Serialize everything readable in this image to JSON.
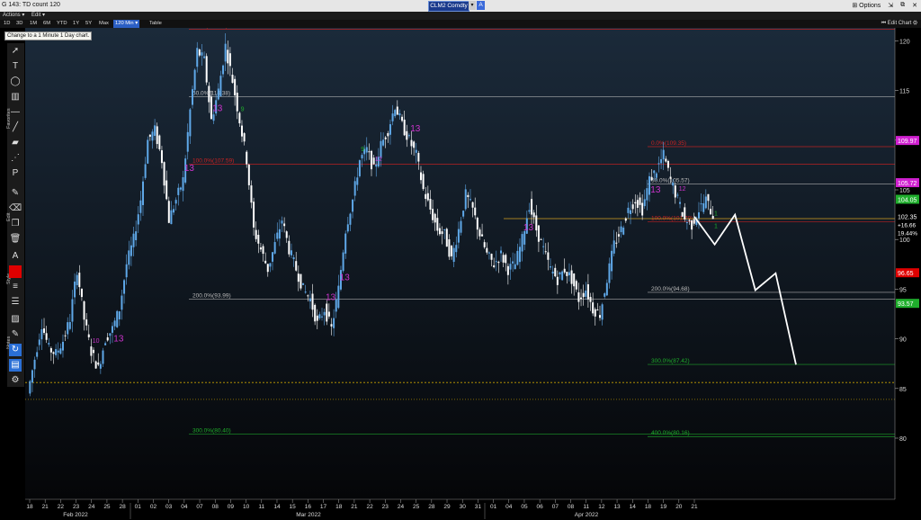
{
  "app": {
    "title": "G 143: TD count 120",
    "ticker": "CLM2 Comdty",
    "ticker_button": "A",
    "options_label": "Options",
    "window_controls": [
      "⇲",
      "⧉",
      "✕"
    ]
  },
  "menu": {
    "items": [
      "Actions ▾",
      "Edit ▾"
    ]
  },
  "range_buttons": [
    "1D",
    "3D",
    "1M",
    "6M",
    "YTD",
    "1Y",
    "5Y",
    "Max",
    "120 Min ▾",
    "Table"
  ],
  "edit_chart_label": "⏮ Edit Chart ⚙",
  "tooltip": "Change to a 1 Minute 1 Day chart.",
  "sidebar_labels": {
    "favorites": "Favorites",
    "edit": "Edit",
    "style": "Style",
    "notes": "Notes"
  },
  "colors": {
    "background": "#000000",
    "up_candle": "#5fa8e8",
    "down_candle": "#ffffff",
    "fib_red": "#cc2222",
    "fib_green": "#1fae2c",
    "magenta": "#cc33cc",
    "projection": "#ffffff"
  },
  "chart_data": {
    "type": "candlestick",
    "y_ticks": [
      80,
      85,
      90,
      95,
      100,
      105,
      110,
      115,
      120
    ],
    "ylim": [
      75,
      122
    ],
    "x_day_labels": [
      "18",
      "21",
      "22",
      "23",
      "24",
      "25",
      "28",
      "01",
      "02",
      "03",
      "04",
      "07",
      "08",
      "09",
      "10",
      "11",
      "14",
      "15",
      "16",
      "17",
      "18",
      "21",
      "22",
      "23",
      "24",
      "25",
      "28",
      "29",
      "30",
      "31",
      "01",
      "04",
      "05",
      "06",
      "07",
      "08",
      "11",
      "12",
      "13",
      "14",
      "18",
      "19",
      "20",
      "21"
    ],
    "month_labels": [
      "Feb 2022",
      "Mar 2022",
      "Apr 2022"
    ],
    "price_path": [
      [
        0,
        84.5
      ],
      [
        2,
        88
      ],
      [
        4,
        91.5
      ],
      [
        5,
        89
      ],
      [
        6,
        88.5
      ],
      [
        7,
        89.8
      ],
      [
        8,
        92
      ],
      [
        9,
        97
      ],
      [
        10,
        92
      ],
      [
        11,
        88.7
      ],
      [
        12,
        87
      ],
      [
        13,
        90
      ],
      [
        14,
        91
      ],
      [
        15,
        93
      ],
      [
        16,
        97.5
      ],
      [
        17,
        100
      ],
      [
        18,
        104
      ],
      [
        19,
        110
      ],
      [
        20,
        111
      ],
      [
        21,
        108
      ],
      [
        22,
        102
      ],
      [
        23,
        104
      ],
      [
        24,
        106
      ],
      [
        25,
        113
      ],
      [
        26,
        119
      ],
      [
        27,
        118
      ],
      [
        28,
        112
      ],
      [
        29,
        115
      ],
      [
        30,
        119.5
      ],
      [
        31,
        116
      ],
      [
        32,
        112
      ],
      [
        33,
        108
      ],
      [
        34,
        101
      ],
      [
        35,
        99
      ],
      [
        36,
        97
      ],
      [
        37,
        99.5
      ],
      [
        38,
        102
      ],
      [
        39,
        99
      ],
      [
        40,
        97
      ],
      [
        41,
        95
      ],
      [
        42,
        94
      ],
      [
        43,
        91.5
      ],
      [
        44,
        93
      ],
      [
        45,
        91
      ],
      [
        46,
        95
      ],
      [
        47,
        101
      ],
      [
        48,
        104
      ],
      [
        49,
        108
      ],
      [
        50,
        109
      ],
      [
        51,
        107
      ],
      [
        52,
        109.5
      ],
      [
        53,
        111
      ],
      [
        54,
        113.5
      ],
      [
        55,
        111.5
      ],
      [
        56,
        110
      ],
      [
        57,
        108.5
      ],
      [
        58,
        105
      ],
      [
        59,
        103
      ],
      [
        60,
        101
      ],
      [
        61,
        100.5
      ],
      [
        62,
        98
      ],
      [
        63,
        101
      ],
      [
        64,
        104.5
      ],
      [
        65,
        103
      ],
      [
        66,
        100.5
      ],
      [
        67,
        98.5
      ],
      [
        68,
        97.5
      ],
      [
        69,
        98.5
      ],
      [
        70,
        97
      ],
      [
        71,
        97.5
      ],
      [
        72,
        100
      ],
      [
        73,
        103.5
      ],
      [
        74,
        101
      ],
      [
        75,
        99
      ],
      [
        76,
        97
      ],
      [
        77,
        96
      ],
      [
        78,
        97
      ],
      [
        79,
        96
      ],
      [
        80,
        94
      ],
      [
        81,
        95
      ],
      [
        82,
        93
      ],
      [
        83,
        92.5
      ],
      [
        84,
        96
      ],
      [
        85,
        99.5
      ],
      [
        86,
        101
      ],
      [
        87,
        103
      ],
      [
        88,
        104
      ],
      [
        89,
        103
      ],
      [
        90,
        106
      ],
      [
        91,
        107
      ],
      [
        92,
        108.5
      ],
      [
        93,
        106
      ],
      [
        94,
        104
      ],
      [
        95,
        102
      ],
      [
        96,
        101.5
      ],
      [
        97,
        103
      ],
      [
        98,
        104
      ],
      [
        99,
        102.4
      ]
    ],
    "current_price": 102.35,
    "price_tags": [
      {
        "label": "109.97",
        "value": 109.97,
        "color": "#d020d0"
      },
      {
        "label": "105.72",
        "value": 105.72,
        "color": "#d020d0"
      },
      {
        "label": "104.05",
        "value": 104.05,
        "color": "#1fae2c"
      },
      {
        "label": "102.35",
        "value": 102.35,
        "color": "#000000"
      },
      {
        "label": "96.65",
        "value": 96.65,
        "color": "#e00000"
      },
      {
        "label": "93.57",
        "value": 93.57,
        "color": "#1fae2c"
      }
    ],
    "price_readouts": [
      "+16.66",
      "19.44%"
    ],
    "fib_labels": [
      {
        "text": "0.0%(121.17)",
        "value": 121.17,
        "color": "#cc2222"
      },
      {
        "text": "50.0%(114.38)",
        "value": 114.38,
        "color": "#bbbbbb"
      },
      {
        "text": "100.0%(107.59)",
        "value": 107.59,
        "color": "#cc2222"
      },
      {
        "text": "200.0%(93.99)",
        "value": 93.99,
        "color": "#bbbbbb"
      },
      {
        "text": "300.0%(80.40)",
        "value": 80.4,
        "color": "#1fae2c"
      },
      {
        "text": "0.0%(109.35)",
        "value": 109.35,
        "color": "#cc2222"
      },
      {
        "text": "50.0%(105.57)",
        "value": 105.57,
        "color": "#bbbbbb"
      },
      {
        "text": "100.0%(101.79)",
        "value": 101.79,
        "color": "#cc2222"
      },
      {
        "text": "200.0%(94.68)",
        "value": 94.68,
        "color": "#bbbbbb"
      },
      {
        "text": "300.0%(87.42)",
        "value": 87.42,
        "color": "#1fae2c"
      },
      {
        "text": "400.0%(80.16)",
        "value": 80.16,
        "color": "#1fae2c"
      }
    ],
    "td_labels": [
      "10",
      "13",
      "13",
      "13",
      "13",
      "12",
      "13",
      "13",
      "13",
      "12",
      "9",
      "13",
      "9",
      "1",
      "1"
    ],
    "projection": [
      [
        102.3,
        0
      ],
      [
        99.5,
        1
      ],
      [
        102.5,
        2
      ],
      [
        94.9,
        3
      ],
      [
        96.6,
        4
      ],
      [
        87.4,
        5
      ]
    ]
  }
}
